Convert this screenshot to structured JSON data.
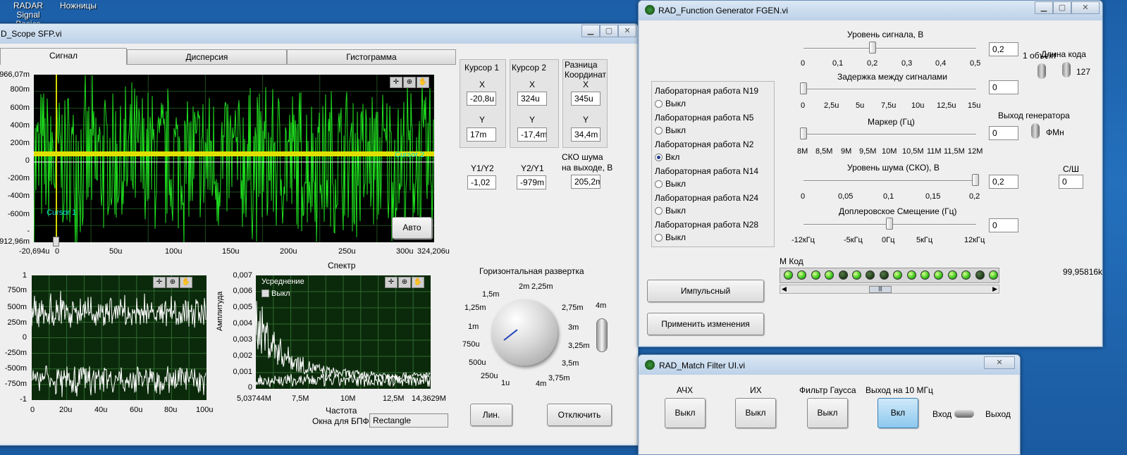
{
  "desktop": {
    "icon_radar": "RADAR\nSignal Basics",
    "icon_radar_l1": "RADAR",
    "icon_radar_l2": "Signal Basics",
    "icon_scissors": "Ножницы"
  },
  "scope": {
    "title": "D_Scope SFP.vi",
    "tabs": [
      "Сигнал",
      "Дисперсия",
      "Гистограмма"
    ],
    "main_graph": {
      "y_ticks": [
        "966,07m",
        "800m",
        "600m",
        "400m",
        "200m",
        "0",
        "-200m",
        "-400m",
        "-600m",
        "-",
        "-912,96m"
      ],
      "x_ticks": [
        "-20,694u",
        "0",
        "50u",
        "100u",
        "150u",
        "200u",
        "250u",
        "300u",
        "324,206u"
      ],
      "cursor1": "Cursor 1",
      "cursor2": "Cursor 2",
      "auto_btn": "Авто"
    },
    "cursor1": {
      "title": "Курсор 1",
      "x_label": "X",
      "x_value": "-20,8u",
      "y_label": "Y",
      "y_value": "17m"
    },
    "cursor2": {
      "title": "Курсор 2",
      "x_label": "X",
      "x_value": "324u",
      "y_label": "Y",
      "y_value": "-17,4m"
    },
    "diff": {
      "title1": "Разница",
      "title2": "Координат",
      "x_label": "X",
      "x_value": "345u",
      "y_label": "Y",
      "y_value": "34,4m"
    },
    "ratio": {
      "y1y2_label": "Y1/Y2",
      "y1y2_value": "-1,02",
      "y2y1_label": "Y2/Y1",
      "y2y1_value": "-979m"
    },
    "sko": {
      "label1": "СКО шума",
      "label2": "на выходе, В",
      "value": "205,2m"
    },
    "small_graph": {
      "y_ticks": [
        "1",
        "750m",
        "500m",
        "250m",
        "0",
        "-250m",
        "-500m",
        "-750m",
        "-1"
      ],
      "x_ticks": [
        "0",
        "20u",
        "40u",
        "60u",
        "80u",
        "100u"
      ]
    },
    "spectrum": {
      "title": "Спектр",
      "ylabel": "Амплитуда",
      "xlabel": "Частота",
      "y_ticks": [
        "0,007",
        "0,006",
        "0,005",
        "0,004",
        "0,003",
        "0,002",
        "0,001",
        "0"
      ],
      "x_ticks": [
        "5,03744M",
        "7,5M",
        "10M",
        "12,5M",
        "14,3629M"
      ],
      "avg_label": "Усреднение",
      "avg_value": "Выкл"
    },
    "fft_window": {
      "label": "Окна для БПФ",
      "value": "Rectangle"
    },
    "hscan": {
      "title": "Горизонтальная развертка",
      "ticks": [
        "1,5m",
        "2m",
        "2,25m",
        "2,75m",
        "1,25m",
        "1m",
        "3m",
        "750u",
        "3,25m",
        "500u",
        "3,5m",
        "250u",
        "1u",
        "4m",
        "3,75m"
      ],
      "side": "4m"
    },
    "btn_lin": "Лин.",
    "btn_off": "Отключить"
  },
  "fgen": {
    "title": "RAD_Function Generator FGEN.vi",
    "labs": [
      {
        "name": "Лабораторная работа  N19",
        "state": "Выкл",
        "on": false
      },
      {
        "name": "Лабораторная работа  N5",
        "state": "Выкл",
        "on": false
      },
      {
        "name": "Лабораторная работа  N2",
        "state": "Вкл",
        "on": true
      },
      {
        "name": "Лабораторная работа  N14",
        "state": "Выкл",
        "on": false
      },
      {
        "name": "Лабораторная работа  N24",
        "state": "Выкл",
        "on": false
      },
      {
        "name": "Лабораторная работа  N28",
        "state": "Выкл",
        "on": false
      }
    ],
    "level": {
      "label": "Уровень сигнала, В",
      "value": "0,2",
      "ticks": [
        "0",
        "0,1",
        "0,2",
        "0,3",
        "0,4",
        "0,5"
      ]
    },
    "delay": {
      "label": "Задержка между сигналами",
      "value": "0",
      "ticks": [
        "0",
        "2,5u",
        "5u",
        "7,5u",
        "10u",
        "12,5u",
        "15u"
      ]
    },
    "marker": {
      "label": "Маркер (Гц)",
      "value": "0",
      "ticks": [
        "8M",
        "8,5M",
        "9M",
        "9,5M",
        "10M",
        "10,5M",
        "11M",
        "11,5M",
        "12M"
      ]
    },
    "noise": {
      "label": "Уровень шума (СКО), В",
      "value": "0,2",
      "ticks": [
        "0",
        "0,05",
        "0,1",
        "0,15",
        "0,2"
      ]
    },
    "doppler": {
      "label": "Доплеровское Смещение (Гц)",
      "value": "0",
      "ticks": [
        "-12кГц",
        "-5кГц",
        "0Гц",
        "5кГц",
        "12кГц"
      ]
    },
    "count_label": "1 объект",
    "code_len_label": "Длина кода",
    "code_len_value": "127",
    "out_label": "Выход генератора",
    "out_value": "ФМн",
    "snr_label": "С/Ш",
    "snr_value": "0",
    "mcode_label": "М Код",
    "mcode_leds": [
      1,
      1,
      1,
      1,
      0,
      1,
      0,
      0,
      1,
      1,
      1,
      1,
      1,
      1,
      0,
      1
    ],
    "freq_value": "99,95816k",
    "btn_pulse": "Импульсный",
    "btn_apply": "Применить изменения"
  },
  "mf": {
    "title": "RAD_Match Filter UI.vi",
    "groups": [
      {
        "label": "АЧХ",
        "btn": "Выкл",
        "active": false
      },
      {
        "label": "ИХ",
        "btn": "Выкл",
        "active": false
      },
      {
        "label": "Фильтр Гаусса",
        "btn": "Выкл",
        "active": false
      },
      {
        "label": "Выход на 10 МГц",
        "btn": "Вкл",
        "active": true
      }
    ],
    "in_label": "Вход",
    "out_label": "Выход"
  }
}
